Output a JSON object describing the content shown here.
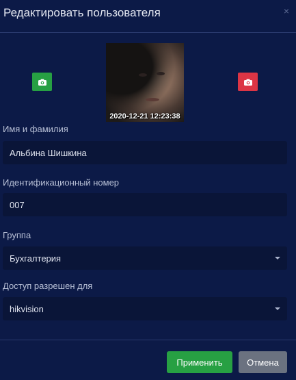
{
  "dialog": {
    "title": "Редактировать пользователя",
    "close_symbol": "×"
  },
  "photo": {
    "timestamp": "2020-12-21 12:23:38"
  },
  "fields": {
    "name": {
      "label": "Имя и фамилия",
      "value": "Альбина Шишкина"
    },
    "id": {
      "label": "Идентификационный номер",
      "value": "007"
    },
    "group": {
      "label": "Группа",
      "value": "Бухгалтерия"
    },
    "access": {
      "label": "Доступ разрешен для",
      "value": "hikvision"
    }
  },
  "footer": {
    "apply_label": "Применить",
    "cancel_label": "Отмена"
  },
  "colors": {
    "background": "#0c1a47",
    "field_bg": "#0a1538",
    "green": "#27a043",
    "red": "#dc3545",
    "gray": "#6b7280"
  },
  "icons": {
    "left_camera": "camera-icon",
    "right_camera": "camera-icon",
    "close": "close-icon",
    "dropdown": "chevron-down-icon"
  }
}
